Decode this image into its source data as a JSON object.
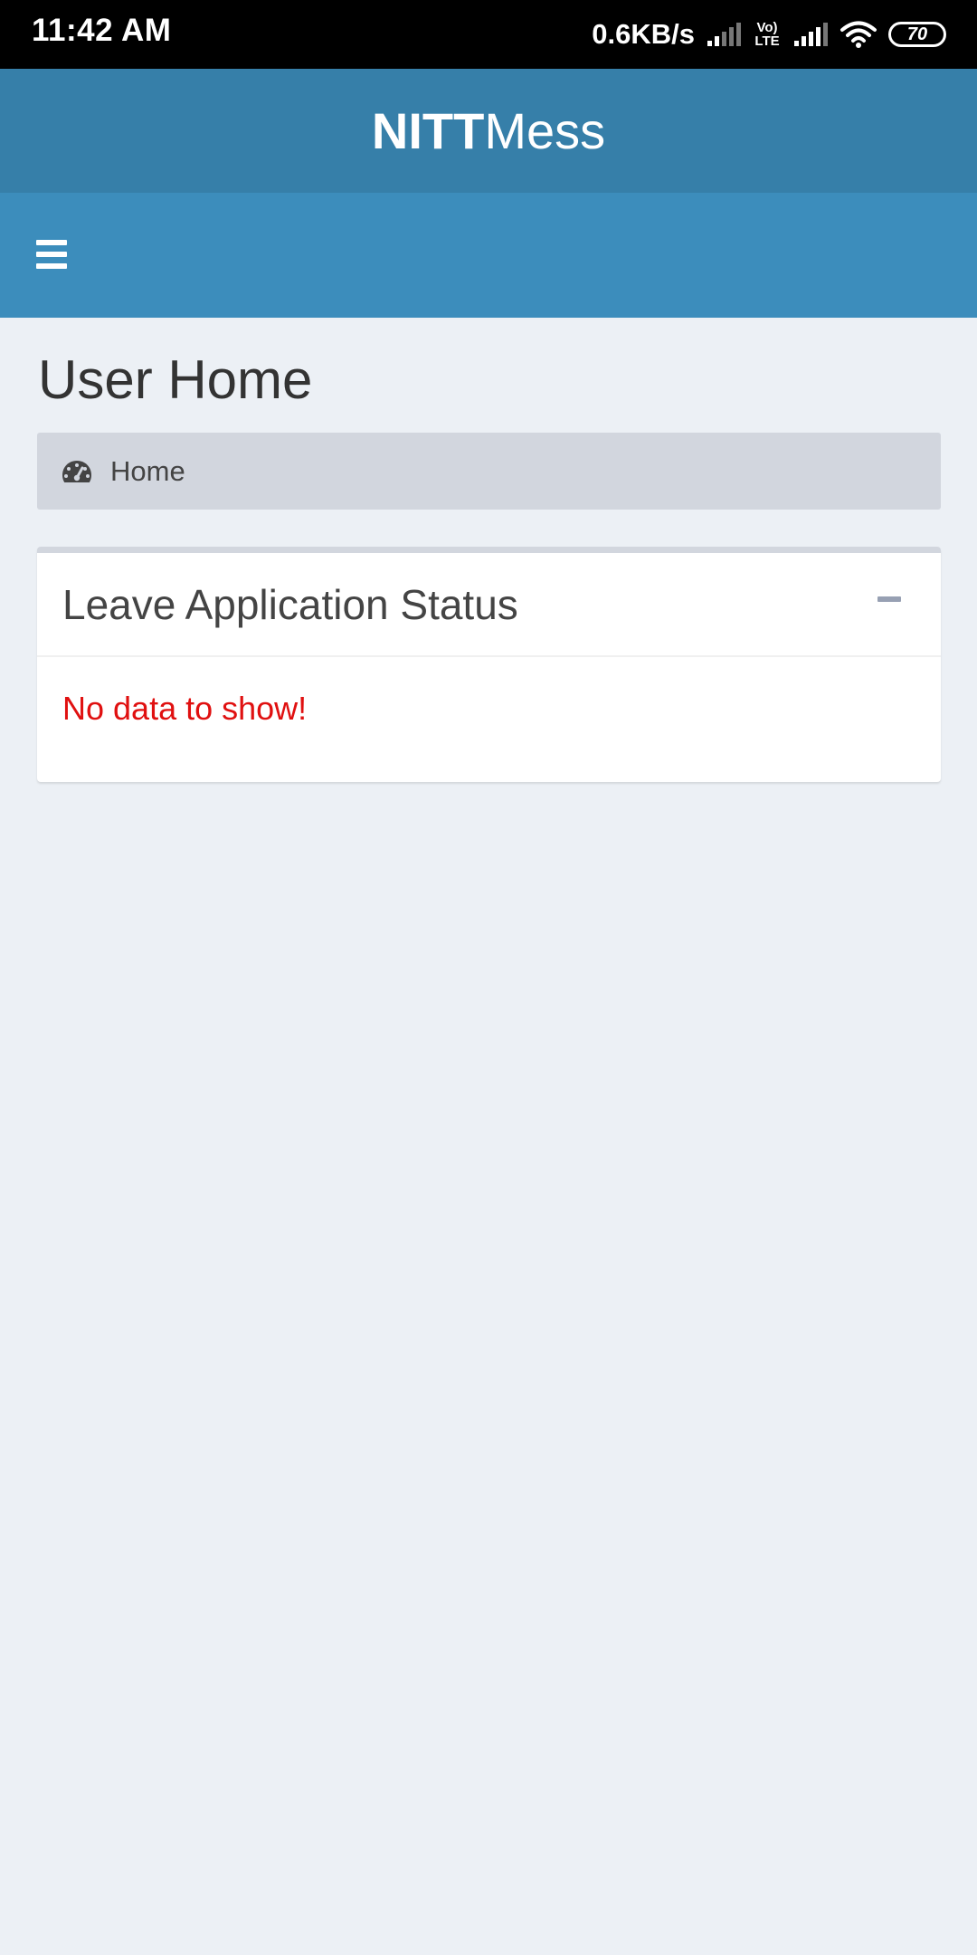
{
  "status_bar": {
    "time": "11:42 AM",
    "net_speed": "0.6KB/s",
    "volte_top": "Vo)",
    "volte_bottom": "LTE",
    "battery": "70"
  },
  "header": {
    "brand_bold": "NITT",
    "brand_light": "Mess"
  },
  "main": {
    "title": "User Home",
    "breadcrumb": {
      "icon": "dashboard-icon",
      "label": "Home"
    },
    "box": {
      "title": "Leave Application Status",
      "collapse_icon": "minus-icon",
      "empty_message": "No data to show!"
    }
  },
  "colors": {
    "header_dark": "#367fa9",
    "header": "#3c8dbc",
    "background": "#ecf0f5",
    "breadcrumb_bg": "#d2d6de",
    "error_text": "#e01010"
  }
}
